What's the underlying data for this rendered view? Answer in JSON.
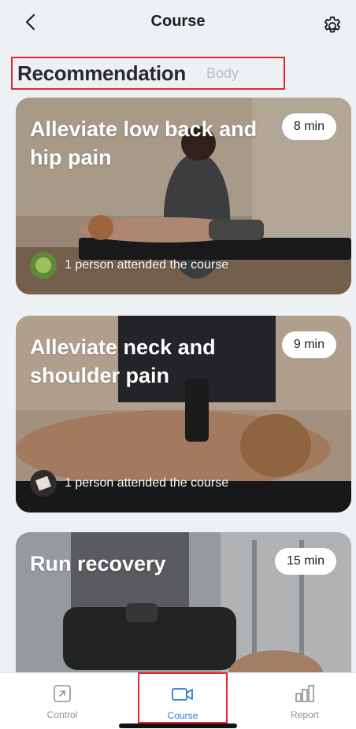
{
  "header": {
    "title": "Course",
    "back_icon": "chevron-left-icon",
    "settings_icon": "gear-icon"
  },
  "segments": {
    "active": "Recommendation",
    "inactive": "Body"
  },
  "courses": [
    {
      "title": "Alleviate low back and hip pain",
      "duration": "8 min",
      "attended": "1  person attended the course"
    },
    {
      "title": "Alleviate neck and shoulder pain",
      "duration": "9 min",
      "attended": "1  person attended the course"
    },
    {
      "title": "Run recovery",
      "duration": "15 min"
    }
  ],
  "tabbar": {
    "items": [
      {
        "label": "Control",
        "icon": "arrow-up-right-box-icon"
      },
      {
        "label": "Course",
        "icon": "video-camera-icon"
      },
      {
        "label": "Report",
        "icon": "bar-chart-icon"
      }
    ]
  },
  "colors": {
    "highlight": "#e3262b",
    "active_tab": "#2f7ad9",
    "inactive_tab": "#8e9297",
    "background": "#eef1f4"
  }
}
